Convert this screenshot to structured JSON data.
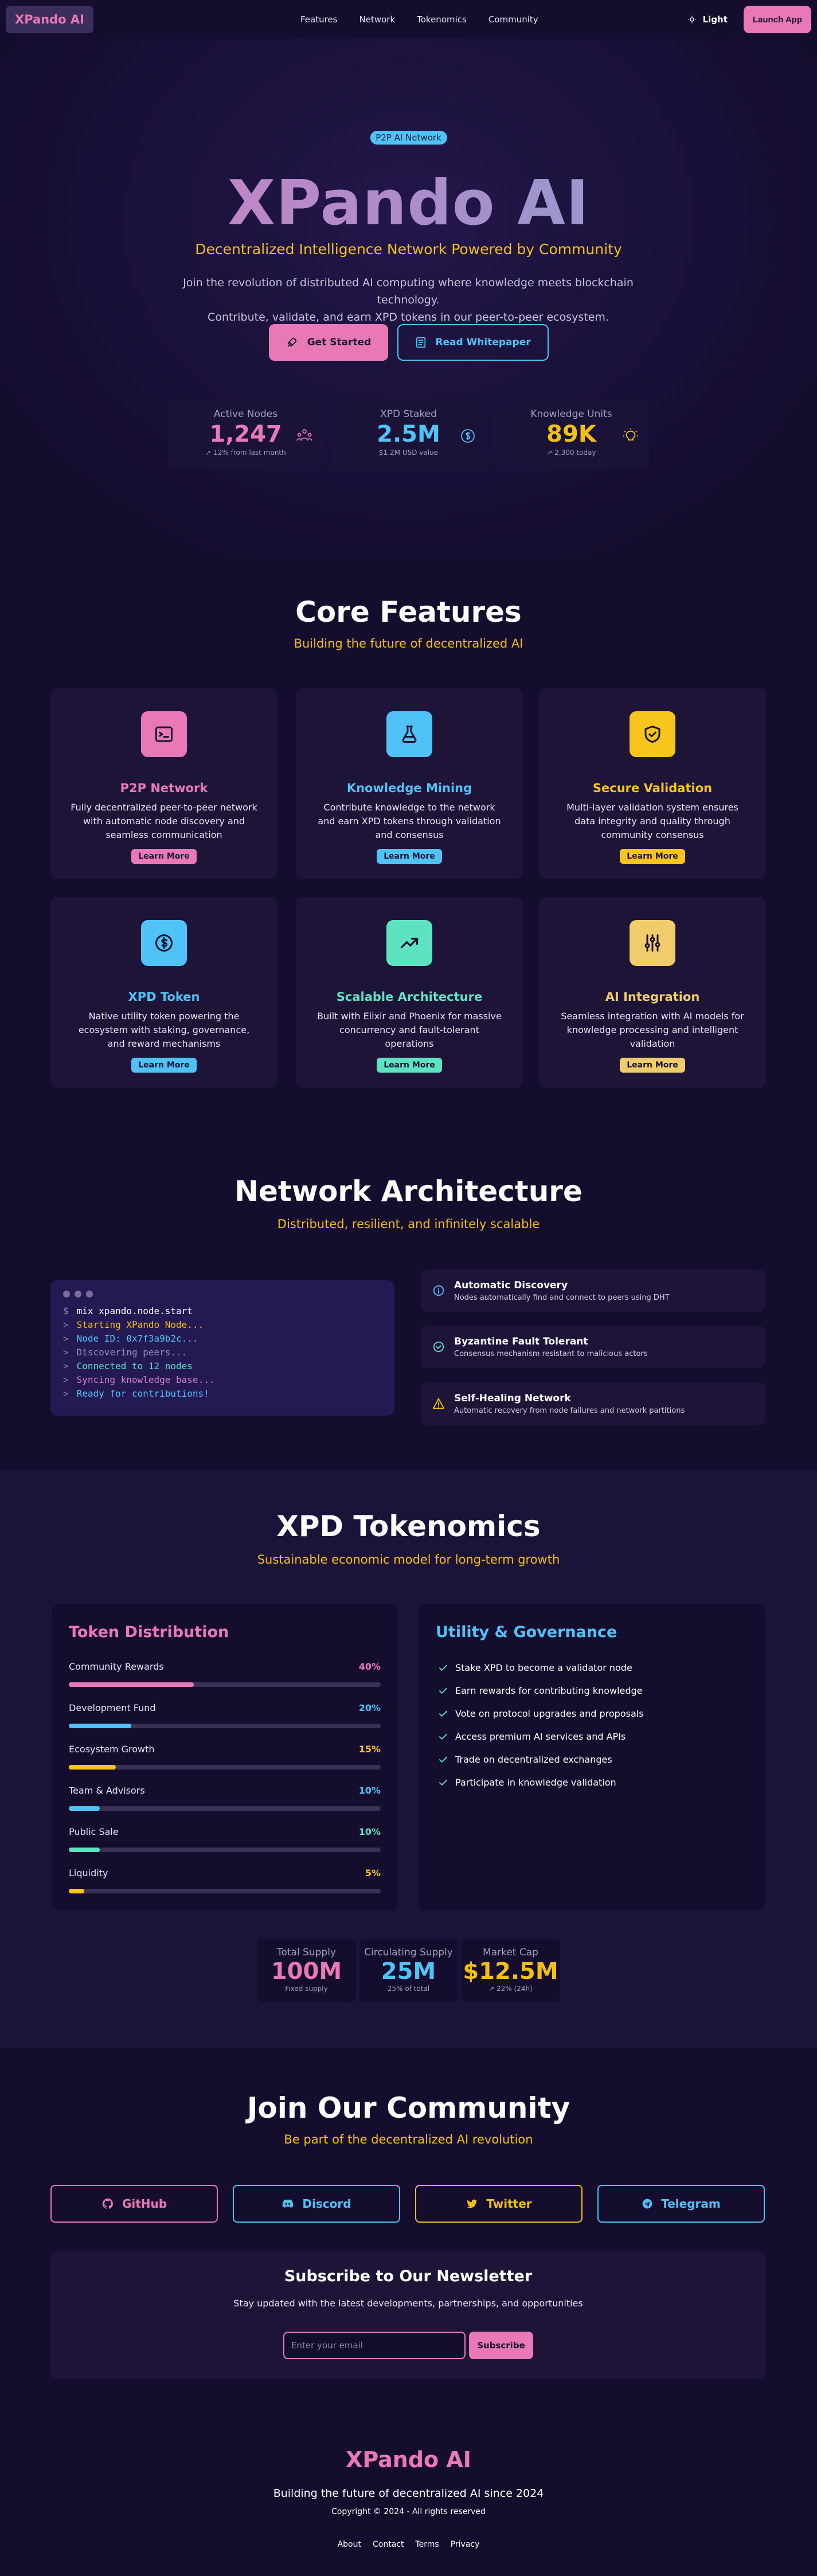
{
  "nav": {
    "brand": "XPando AI",
    "links": [
      "Features",
      "Network",
      "Tokenomics",
      "Community"
    ],
    "theme_label": "Light",
    "launch_label": "Launch App"
  },
  "hero": {
    "tag": "P2P AI Network",
    "title": "XPando AI",
    "subtitle": "Decentralized Intelligence Network Powered by Community",
    "description_line1": "Join the revolution of distributed AI computing where knowledge meets blockchain technology.",
    "description_line2": "Contribute, validate, and earn XPD tokens in our peer-to-peer ecosystem.",
    "primary_button": "Get Started",
    "secondary_button": "Read Whitepaper",
    "stats": [
      {
        "label": "Active Nodes",
        "value": "1,247",
        "sub": "↗ 12% from last month",
        "color": "#e879b6",
        "icon": "network-icon"
      },
      {
        "label": "XPD Staked",
        "value": "2.5M",
        "sub": "$1.2M USD value",
        "color": "#4fc3f7",
        "icon": "dollar-coin-icon"
      },
      {
        "label": "Knowledge Units",
        "value": "89K",
        "sub": "↗ 2,300 today",
        "color": "#f2c013",
        "icon": "lightbulb-icon"
      }
    ]
  },
  "features": {
    "title": "Core Features",
    "subtitle": "Building the future of decentralized AI",
    "cards": [
      {
        "title": "P2P Network",
        "desc": "Fully decentralized peer-to-peer network with automatic node discovery and seamless communication",
        "button": "Learn More",
        "color": "#e879b6",
        "icon": "terminal-icon"
      },
      {
        "title": "Knowledge Mining",
        "desc": "Contribute knowledge to the network and earn XPD tokens through validation and consensus",
        "button": "Learn More",
        "color": "#4fc3f7",
        "icon": "flask-icon"
      },
      {
        "title": "Secure Validation",
        "desc": "Multi-layer validation system ensures data integrity and quality through community consensus",
        "button": "Learn More",
        "color": "#f7c51b",
        "icon": "shield-check-icon"
      },
      {
        "title": "XPD Token",
        "desc": "Native utility token powering the ecosystem with staking, governance, and reward mechanisms",
        "button": "Learn More",
        "color": "#4fc3f7",
        "icon": "coin-icon"
      },
      {
        "title": "Scalable Architecture",
        "desc": "Built with Elixir and Phoenix for massive concurrency and fault-tolerant operations",
        "button": "Learn More",
        "color": "#5ee3c1",
        "icon": "trending-up-icon"
      },
      {
        "title": "AI Integration",
        "desc": "Seamless integration with AI models for knowledge processing and intelligent validation",
        "button": "Learn More",
        "color": "#f0cd6a",
        "icon": "sliders-icon"
      }
    ]
  },
  "network": {
    "title": "Network Architecture",
    "subtitle": "Distributed, resilient, and infinitely scalable",
    "terminal_lines": [
      {
        "prompt": "$",
        "text": "mix xpando.node.start",
        "color": "#ffffff"
      },
      {
        "prompt": ">",
        "text": "Starting XPando Node...",
        "color": "#f2c013"
      },
      {
        "prompt": ">",
        "text": "Node ID: 0x7f3a9b2c...",
        "color": "#4fc3f7"
      },
      {
        "prompt": ">",
        "text": "Discovering peers...",
        "color": "#9a8fc0"
      },
      {
        "prompt": ">",
        "text": "Connected to 12 nodes",
        "color": "#5ee3c1"
      },
      {
        "prompt": ">",
        "text": "Syncing knowledge base...",
        "color": "#d67fc4"
      },
      {
        "prompt": ">",
        "text": "Ready for contributions!",
        "color": "#4fc3f7"
      }
    ],
    "features": [
      {
        "title": "Automatic Discovery",
        "desc": "Nodes automatically find and connect to peers using DHT",
        "icon": "info-icon",
        "color": "#4fc3f7"
      },
      {
        "title": "Byzantine Fault Tolerant",
        "desc": "Consensus mechanism resistant to malicious actors",
        "icon": "check-circle-icon",
        "color": "#5ee3c1"
      },
      {
        "title": "Self-Healing Network",
        "desc": "Automatic recovery from node failures and network partitions",
        "icon": "warning-icon",
        "color": "#f2c013"
      }
    ]
  },
  "tokenomics": {
    "title": "XPD Tokenomics",
    "subtitle": "Sustainable economic model for long-term growth",
    "distribution_title": "Token Distribution",
    "distribution": [
      {
        "label": "Community Rewards",
        "percent": "40%",
        "value": 40,
        "color": "#e879b6"
      },
      {
        "label": "Development Fund",
        "percent": "20%",
        "value": 20,
        "color": "#4fc3f7"
      },
      {
        "label": "Ecosystem Growth",
        "percent": "15%",
        "value": 15,
        "color": "#f7c51b"
      },
      {
        "label": "Team & Advisors",
        "percent": "10%",
        "value": 10,
        "color": "#4fc3f7"
      },
      {
        "label": "Public Sale",
        "percent": "10%",
        "value": 10,
        "color": "#5ee3c1"
      },
      {
        "label": "Liquidity",
        "percent": "5%",
        "value": 5,
        "color": "#f7c51b"
      }
    ],
    "utility_title": "Utility & Governance",
    "utility": [
      "Stake XPD to become a validator node",
      "Earn rewards for contributing knowledge",
      "Vote on protocol upgrades and proposals",
      "Access premium AI services and APIs",
      "Trade on decentralized exchanges",
      "Participate in knowledge validation"
    ],
    "stats": [
      {
        "label": "Total Supply",
        "value": "100M",
        "sub": "Fixed supply",
        "color": "#e879b6"
      },
      {
        "label": "Circulating Supply",
        "value": "25M",
        "sub": "25% of total",
        "color": "#4fc3f7"
      },
      {
        "label": "Market Cap",
        "value": "$12.5M",
        "sub": "↗ 22% (24h)",
        "color": "#f2c013"
      }
    ]
  },
  "community": {
    "title": "Join Our Community",
    "subtitle": "Be part of the decentralized AI revolution",
    "socials": [
      {
        "label": "GitHub",
        "color": "#e879b6",
        "icon": "github-icon"
      },
      {
        "label": "Discord",
        "color": "#4fc3f7",
        "icon": "discord-icon"
      },
      {
        "label": "Twitter",
        "color": "#f2c013",
        "icon": "twitter-icon"
      },
      {
        "label": "Telegram",
        "color": "#4fc3f7",
        "icon": "telegram-icon"
      }
    ],
    "newsletter": {
      "title": "Subscribe to Our Newsletter",
      "desc": "Stay updated with the latest developments, partnerships, and opportunities",
      "placeholder": "Enter your email",
      "button": "Subscribe"
    }
  },
  "footer": {
    "brand": "XPando AI",
    "tagline": "Building the future of decentralized AI since 2024",
    "copyright": "Copyright © 2024 - All rights reserved",
    "links": [
      "About",
      "Contact",
      "Terms",
      "Privacy"
    ]
  }
}
